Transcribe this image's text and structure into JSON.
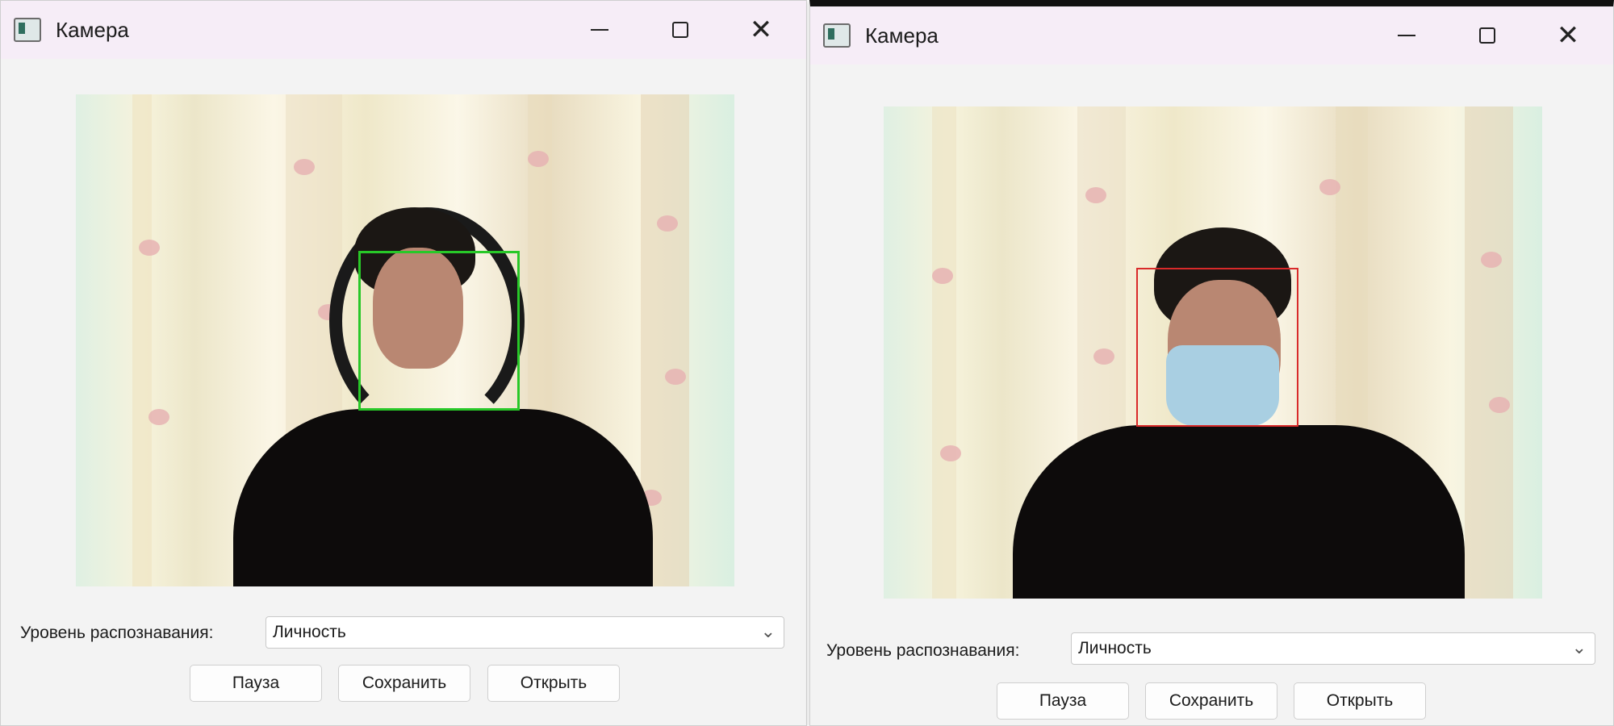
{
  "windows": [
    {
      "title": "Камера",
      "recognition_label": "Уровень распознавания:",
      "recognition_value": "Личность",
      "buttons": {
        "pause": "Пауза",
        "save": "Сохранить",
        "open": "Открыть"
      },
      "detection_box_color": "#28c828"
    },
    {
      "title": "Камера",
      "recognition_label": "Уровень распознавания:",
      "recognition_value": "Личность",
      "buttons": {
        "pause": "Пауза",
        "save": "Сохранить",
        "open": "Открыть"
      },
      "detection_box_color": "#d92a2a"
    }
  ],
  "icons": {
    "app": "camera-app-icon",
    "minimize": "minimize-icon",
    "maximize": "maximize-icon",
    "close": "close-icon",
    "dropdown": "chevron-down-icon"
  }
}
